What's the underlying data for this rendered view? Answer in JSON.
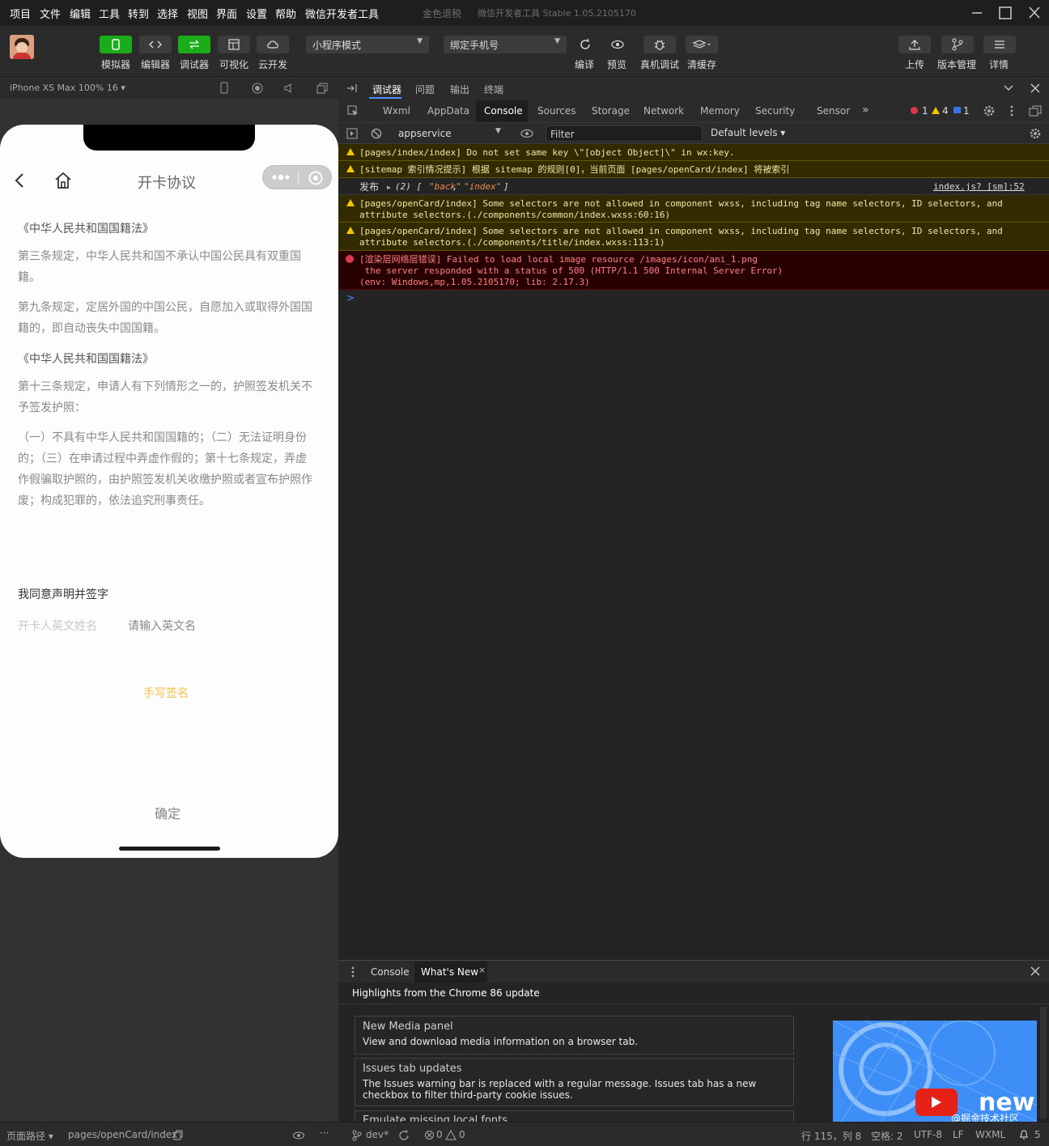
{
  "menubar": {
    "items": [
      "项目",
      "文件",
      "编辑",
      "工具",
      "转到",
      "选择",
      "视图",
      "界面",
      "设置",
      "帮助",
      "微信开发者工具"
    ],
    "project_name": "金色退税",
    "app_version": "微信开发者工具 Stable 1.05.2105170"
  },
  "toolbar": {
    "left_buttons": [
      "模拟器",
      "编辑器",
      "调试器",
      "可视化",
      "云开发"
    ],
    "mode_select": "小程序模式",
    "compile_select": "绑定手机号",
    "action_buttons": [
      "编译",
      "预览",
      "真机调试",
      "清缓存"
    ],
    "right_buttons": [
      "上传",
      "版本管理",
      "详情"
    ]
  },
  "simulator": {
    "device": "iPhone XS Max 100% 16 ▾"
  },
  "phone": {
    "nav_title": "开卡协议",
    "paragraphs": [
      "《中华人民共和国国籍法》",
      "第三条规定，中华人民共和国不承认中国公民具有双重国籍。",
      "第九条规定，定居外国的中国公民，自愿加入或取得外国国籍的，即自动丧失中国国籍。",
      "《中华人民共和国国籍法》",
      "第十三条规定，申请人有下列情形之一的，护照签发机关不予签发护照：",
      "（一）不具有中华人民共和国国籍的；（二）无法证明身份的；（三）在申请过程中弄虚作假的；第十七条规定，弄虚作假骗取护照的，由护照签发机关收缴护照或者宣布护照作废；构成犯罪的，依法追究刑事责任。"
    ],
    "consent_label": "我同意声明并签字",
    "name_label": "开卡人英文姓名",
    "name_placeholder": "请输入英文名",
    "sign_link": "手写签名",
    "confirm_button": "确定"
  },
  "devtools": {
    "top_tabs": [
      "调试器",
      "问题",
      "输出",
      "终端"
    ],
    "panel_tabs": [
      "Wxml",
      "AppData",
      "Console",
      "Sources",
      "Storage",
      "Network",
      "Memory",
      "Security",
      "Sensor"
    ],
    "more": "»",
    "counts": {
      "errors": "1",
      "warnings": "4",
      "infos": "1"
    },
    "context": "appservice",
    "filter_placeholder": "Filter",
    "levels": "Default levels ▾",
    "console": {
      "w1": "[pages/index/index] Do not set same key \\\"[object Object]\\\" in wx:key.",
      "w2": "[sitemap 索引情况提示] 根据 sitemap 的规则[0]，当前页面 [pages/openCard/index] 将被索引",
      "log_label": "发布",
      "log_count": "(2) [",
      "log_v1": "\"back\"",
      "log_sep": ", ",
      "log_v2": "\"index\"",
      "log_end": "]",
      "log_link": "index.js? [sm]:52",
      "w3a": "[pages/openCard/index] Some selectors are not allowed in component wxss, including tag name selectors, ID selectors, and",
      "w3b": "attribute selectors.(./components/common/index.wxss:60:16)",
      "w4a": "[pages/openCard/index] Some selectors are not allowed in component wxss, including tag name selectors, ID selectors, and",
      "w4b": "attribute selectors.(./components/title/index.wxss:113:1)",
      "e1a": "[渲染层网络层错误] Failed to load local image resource /images/icon/ani_1.png",
      "e1b": " the server responded with a status of 500 (HTTP/1.1 500 Internal Server Error)",
      "e1c": "(env: Windows,mp,1.05.2105170; lib: 2.17.3)",
      "prompt": ">"
    }
  },
  "drawer": {
    "tabs": [
      "Console",
      "What's New"
    ],
    "close_tab": "×",
    "headline": "Highlights from the Chrome 86 update",
    "cards": [
      {
        "title": "New Media panel",
        "desc": "View and download media information on a browser tab."
      },
      {
        "title": "Issues tab updates",
        "desc": "The Issues warning bar is replaced with a regular message. Issues tab has a new checkbox to filter third-party cookie issues."
      },
      {
        "title": "Emulate missing local fonts",
        "desc": ""
      }
    ],
    "video_text": "new",
    "watermark": "@掘金技术社区"
  },
  "statusbar": {
    "page_path_label": "页面路径 ▾",
    "page_path": "pages/openCard/index",
    "branch": "dev*",
    "err_count": "0",
    "warn_count": "0",
    "position": "行 115，列 8",
    "spaces": "空格: 2",
    "encoding": "UTF-8",
    "eol": "LF",
    "lang": "WXML",
    "notifications": "5"
  },
  "colors": {
    "accent_green": "#1aad19",
    "sign_link": "#f5c342",
    "warning_bg": "#332b00",
    "error_bg": "#290000"
  }
}
